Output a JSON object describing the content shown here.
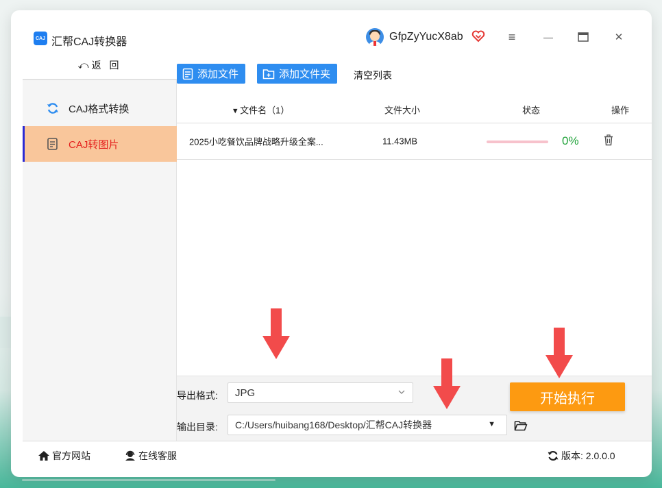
{
  "app": {
    "title": "汇帮CAJ转换器",
    "icon_text": "CAJ"
  },
  "user": {
    "name": "GfpZyYucX8ab"
  },
  "window_controls": {
    "menu": "≡",
    "minimize": "—",
    "maximize": "▭",
    "close": "✕"
  },
  "sidebar": {
    "back_label": "返 回",
    "items": [
      {
        "label": "CAJ格式转换",
        "icon": "refresh-icon",
        "active": false
      },
      {
        "label": "CAJ转图片",
        "icon": "document-icon",
        "active": true
      }
    ]
  },
  "toolbar": {
    "add_file": "添加文件",
    "add_folder": "添加文件夹",
    "clear_list": "清空列表"
  },
  "table": {
    "headers": {
      "name": "文件名（1）",
      "size": "文件大小",
      "status": "状态",
      "action": "操作"
    },
    "rows": [
      {
        "name": "2025小吃餐饮品牌战略升级全案...",
        "size": "11.43MB",
        "progress": 0,
        "percent": "0%"
      }
    ]
  },
  "settings": {
    "format_label": "导出格式:",
    "format_value": "JPG",
    "dir_label": "输出目录:",
    "dir_value": "C:/Users/huibang168/Desktop/汇帮CAJ转换器",
    "start_label": "开始执行"
  },
  "footer": {
    "website": "官方网站",
    "service": "在线客服",
    "version": "版本: 2.0.0.0"
  },
  "colors": {
    "accent_blue": "#2e8df0",
    "start_orange": "#fd9a11",
    "active_bg": "#f9c69b",
    "active_text": "#e5211d",
    "arrow_red": "#f24b4b"
  }
}
